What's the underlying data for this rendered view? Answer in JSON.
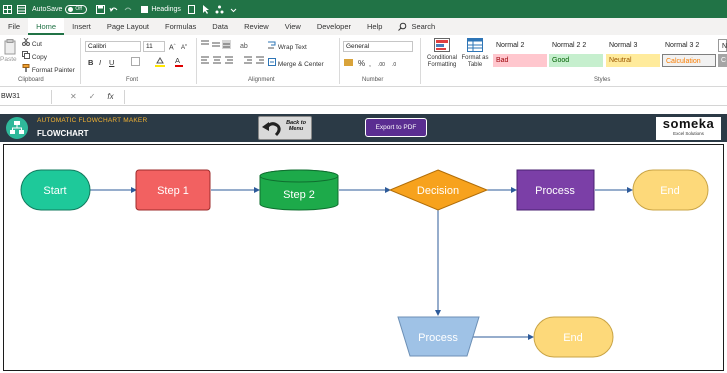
{
  "titlebar": {
    "autosave_label": "AutoSave",
    "autosave_state": "Off",
    "headings_label": "Headings"
  },
  "menu": {
    "tabs": [
      "File",
      "Home",
      "Insert",
      "Page Layout",
      "Formulas",
      "Data",
      "Review",
      "View",
      "Developer",
      "Help"
    ],
    "active_tab": "Home",
    "search_label": "Search"
  },
  "ribbon": {
    "clipboard": {
      "paste_label": "Paste",
      "cut_label": "Cut",
      "copy_label": "Copy",
      "format_painter_label": "Format Painter",
      "group_label": "Clipboard"
    },
    "font": {
      "font_name": "Calibri",
      "font_size": "11",
      "group_label": "Font"
    },
    "alignment": {
      "wrap_text_label": "Wrap Text",
      "merge_center_label": "Merge & Center",
      "group_label": "Alignment"
    },
    "number": {
      "format": "General",
      "group_label": "Number"
    },
    "styles": {
      "conditional_formatting_label": "Conditional",
      "conditional_formatting_label2": "Formatting",
      "format_as_table_label": "Format as",
      "format_as_table_label2": "Table",
      "cells": [
        {
          "name": "Normal 2",
          "color": "#ffffff",
          "text_color": "#222222"
        },
        {
          "name": "Normal 2 2",
          "color": "#ffffff",
          "text_color": "#222222"
        },
        {
          "name": "Normal 3",
          "color": "#ffffff",
          "text_color": "#222222"
        },
        {
          "name": "Normal 3 2",
          "color": "#ffffff",
          "text_color": "#222222"
        },
        {
          "name": "N",
          "color": "#ffffff",
          "text_color": "#222222"
        },
        {
          "name": "Bad",
          "color": "#ffc7ce",
          "text_color": "#9c0006"
        },
        {
          "name": "Good",
          "color": "#c6efce",
          "text_color": "#006100"
        },
        {
          "name": "Neutral",
          "color": "#ffeb9c",
          "text_color": "#9c5700"
        },
        {
          "name": "Calculation",
          "color": "#f2f2f2",
          "text_color": "#fa7d00"
        },
        {
          "name": "C",
          "color": "#a5a5a5",
          "text_color": "#ffffff"
        }
      ],
      "group_label": "Styles"
    }
  },
  "formula_bar": {
    "name_box": "BW31",
    "fx_label": "fx",
    "value": ""
  },
  "header": {
    "subtitle": "AUTOMATIC FLOWCHART MAKER",
    "title": "FLOWCHART",
    "back_label_line1": "Back to",
    "back_label_line2": "Menu",
    "export_label": "Export to PDF",
    "brand": "someka",
    "brand_tagline": "Excel Solutions"
  },
  "flowchart": {
    "nodes": [
      {
        "label": "Start",
        "shape": "terminator",
        "color": "#1ec99a"
      },
      {
        "label": "Step 1",
        "shape": "rectangle",
        "color": "#f26161"
      },
      {
        "label": "Step 2",
        "shape": "cylinder",
        "color": "#1daa4a"
      },
      {
        "label": "Decision",
        "shape": "diamond",
        "color": "#f7a21d"
      },
      {
        "label": "Process",
        "shape": "rectangle",
        "color": "#7b3fa7"
      },
      {
        "label": "End",
        "shape": "terminator",
        "color": "#fdd97a"
      },
      {
        "label": "Process",
        "shape": "trapezoid",
        "color": "#9fc2e6"
      },
      {
        "label": "End",
        "shape": "terminator",
        "color": "#fdd97a"
      }
    ],
    "edge_color": "#2e5b9a"
  }
}
